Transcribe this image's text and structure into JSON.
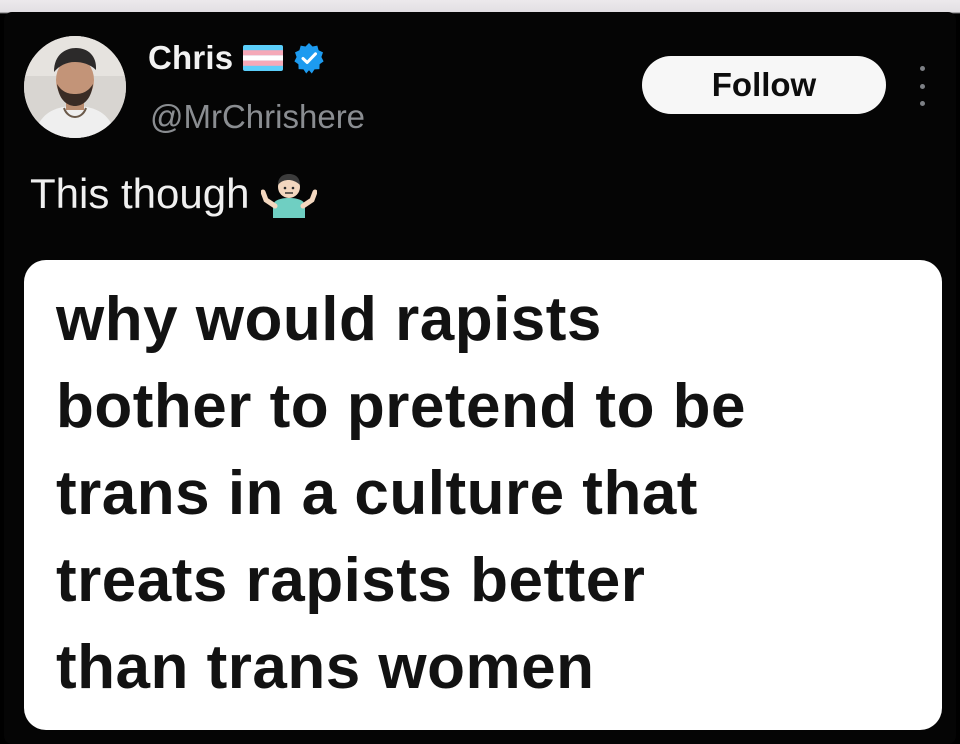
{
  "author": {
    "display_name": "Chris",
    "handle": "@MrChrishere",
    "flag_icon": "transgender-flag-icon",
    "verified_icon": "verified-badge-icon",
    "verified_color": "#1d9bf0"
  },
  "actions": {
    "follow_label": "Follow",
    "more_icon": "more-vertical-icon"
  },
  "tweet": {
    "text": "This though",
    "emoji_icon": "person-shrugging-icon"
  },
  "quoted": {
    "lines": [
      "why would rapists",
      "bother to pretend to be",
      "trans in a culture that",
      "treats rapists better",
      "than trans women"
    ]
  },
  "colors": {
    "background": "#050505",
    "card": "#ffffff",
    "handle": "#8a8d91",
    "flag_blue": "#5bcefa",
    "flag_pink": "#f5a9b8"
  }
}
